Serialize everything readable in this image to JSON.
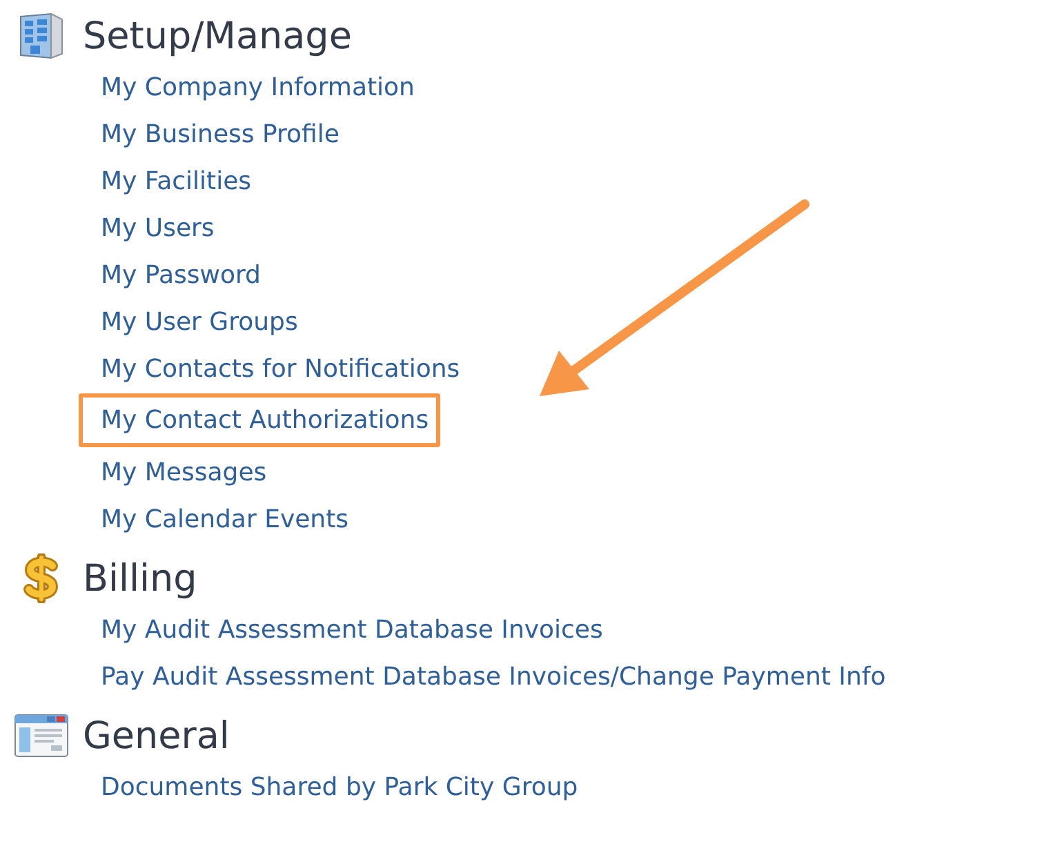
{
  "sections": [
    {
      "title": "Setup/Manage",
      "kind": "building",
      "links": [
        {
          "label": "My Company Information",
          "highlighted": false
        },
        {
          "label": "My Business Profile",
          "highlighted": false
        },
        {
          "label": "My Facilities",
          "highlighted": false
        },
        {
          "label": "My Users",
          "highlighted": false
        },
        {
          "label": "My Password",
          "highlighted": false
        },
        {
          "label": "My User Groups",
          "highlighted": false
        },
        {
          "label": "My Contacts for Notifications",
          "highlighted": false
        },
        {
          "label": "My Contact Authorizations",
          "highlighted": true
        },
        {
          "label": "My Messages",
          "highlighted": false
        },
        {
          "label": "My Calendar Events",
          "highlighted": false
        }
      ]
    },
    {
      "title": "Billing",
      "kind": "dollar",
      "links": [
        {
          "label": "My Audit Assessment Database Invoices",
          "highlighted": false
        },
        {
          "label": "Pay Audit Assessment Database Invoices/Change Payment Info",
          "highlighted": false
        }
      ]
    },
    {
      "title": "General",
      "kind": "window",
      "links": [
        {
          "label": "Documents Shared by Park City Group",
          "highlighted": false
        }
      ]
    }
  ]
}
